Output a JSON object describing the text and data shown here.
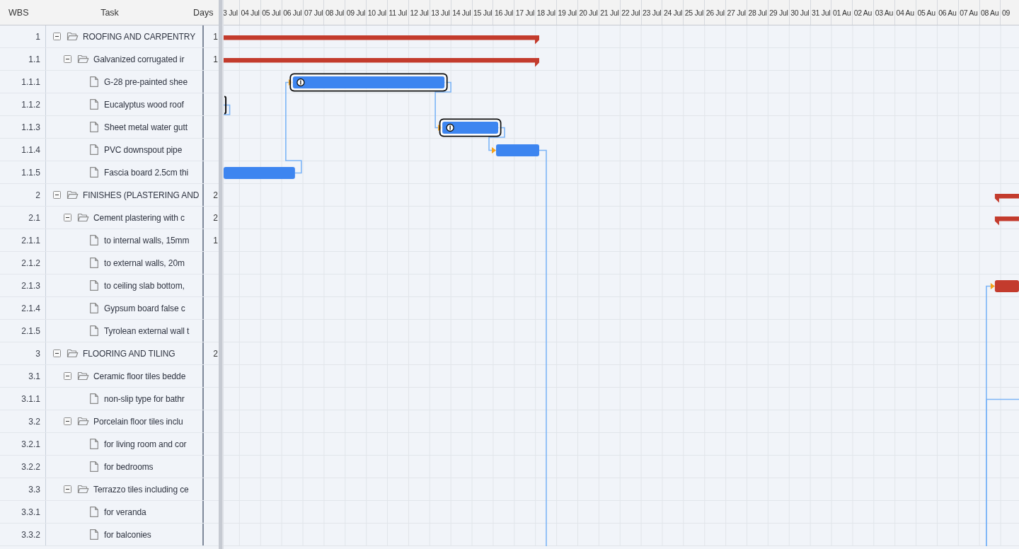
{
  "columns": [
    "WBS",
    "Task",
    "Days"
  ],
  "tasks": [
    {
      "wbs": "1",
      "name": "ROOFING AND CARPENTRY",
      "days": "1",
      "expanded": true,
      "bar": {
        "selected": false,
        "color": "#c33b2d"
      },
      "children": [
        {
          "wbs": "1.1",
          "name": "Galvanized corrugated ir",
          "days": "1",
          "expanded": true,
          "bar": {
            "selected": false,
            "color": "#c33b2d"
          },
          "children": [
            {
              "wbs": "1.1.1",
              "name": "G-28 pre-painted shee",
              "bar": {
                "selected": true,
                "color": "#3d85f0"
              }
            },
            {
              "wbs": "1.1.2",
              "name": "Eucalyptus wood roof",
              "bar": {
                "selected": true
              }
            },
            {
              "wbs": "1.1.3",
              "name": "Sheet metal water gutt",
              "bar": {
                "selected": true,
                "color": "#3d85f0"
              }
            },
            {
              "wbs": "1.1.4",
              "name": "PVC downspout pipe",
              "bar": {
                "selected": false,
                "color": "#3d85f0"
              }
            },
            {
              "wbs": "1.1.5",
              "name": "Fascia board 2.5cm thi",
              "bar": {
                "selected": false,
                "color": "#3d85f0"
              }
            }
          ]
        }
      ]
    },
    {
      "wbs": "2",
      "name": "FINISHES (PLASTERING AND",
      "days": "2",
      "expanded": true,
      "bar": {
        "selected": false,
        "color": "#c33b2d"
      },
      "children": [
        {
          "wbs": "2.1",
          "name": "Cement plastering with c",
          "days": "2",
          "expanded": true,
          "bar": {
            "selected": false,
            "color": "#c33b2d"
          },
          "children": [
            {
              "wbs": "2.1.1",
              "name": "to internal walls, 15mm",
              "days": "1"
            },
            {
              "wbs": "2.1.2",
              "name": "to external walls, 20m"
            },
            {
              "wbs": "2.1.3",
              "name": "to ceiling slab bottom,",
              "bar": {
                "selected": false,
                "color": "#c33b2d"
              }
            },
            {
              "wbs": "2.1.4",
              "name": "Gypsum board false c"
            },
            {
              "wbs": "2.1.5",
              "name": "Tyrolean external wall t"
            }
          ]
        }
      ]
    },
    {
      "wbs": "3",
      "name": "FLOORING AND TILING",
      "days": "2",
      "expanded": true,
      "children": [
        {
          "wbs": "3.1",
          "name": "Ceramic floor tiles bedde",
          "expanded": true,
          "children": [
            {
              "wbs": "3.1.1",
              "name": "non-slip type for bathr"
            }
          ]
        },
        {
          "wbs": "3.2",
          "name": "Porcelain floor tiles inclu",
          "expanded": true,
          "children": [
            {
              "wbs": "3.2.1",
              "name": "for living room and cor"
            },
            {
              "wbs": "3.2.2",
              "name": "for bedrooms"
            }
          ]
        },
        {
          "wbs": "3.3",
          "name": "Terrazzo tiles including ce",
          "expanded": true,
          "children": [
            {
              "wbs": "3.3.1",
              "name": "for veranda"
            },
            {
              "wbs": "3.3.2",
              "name": "for balconies"
            }
          ]
        }
      ]
    }
  ],
  "gantt": {
    "dates": [
      "3 Jul",
      "04 Jul",
      "05 Jul",
      "06 Jul",
      "07 Jul",
      "08 Jul",
      "09 Jul",
      "10 Jul",
      "11 Jul",
      "12 Jul",
      "13 Jul",
      "14 Jul",
      "15 Jul",
      "16 Jul",
      "17 Jul",
      "18 Jul",
      "19 Jul",
      "20 Jul",
      "21 Jul",
      "22 Jul",
      "23 Jul",
      "24 Jul",
      "25 Jul",
      "26 Jul",
      "27 Jul",
      "28 Jul",
      "29 Jul",
      "30 Jul",
      "31 Jul",
      "01 Au",
      "02 Au",
      "03 Au",
      "04 Au",
      "05 Au",
      "06 Au",
      "07 Au",
      "08 Au",
      "09"
    ]
  }
}
